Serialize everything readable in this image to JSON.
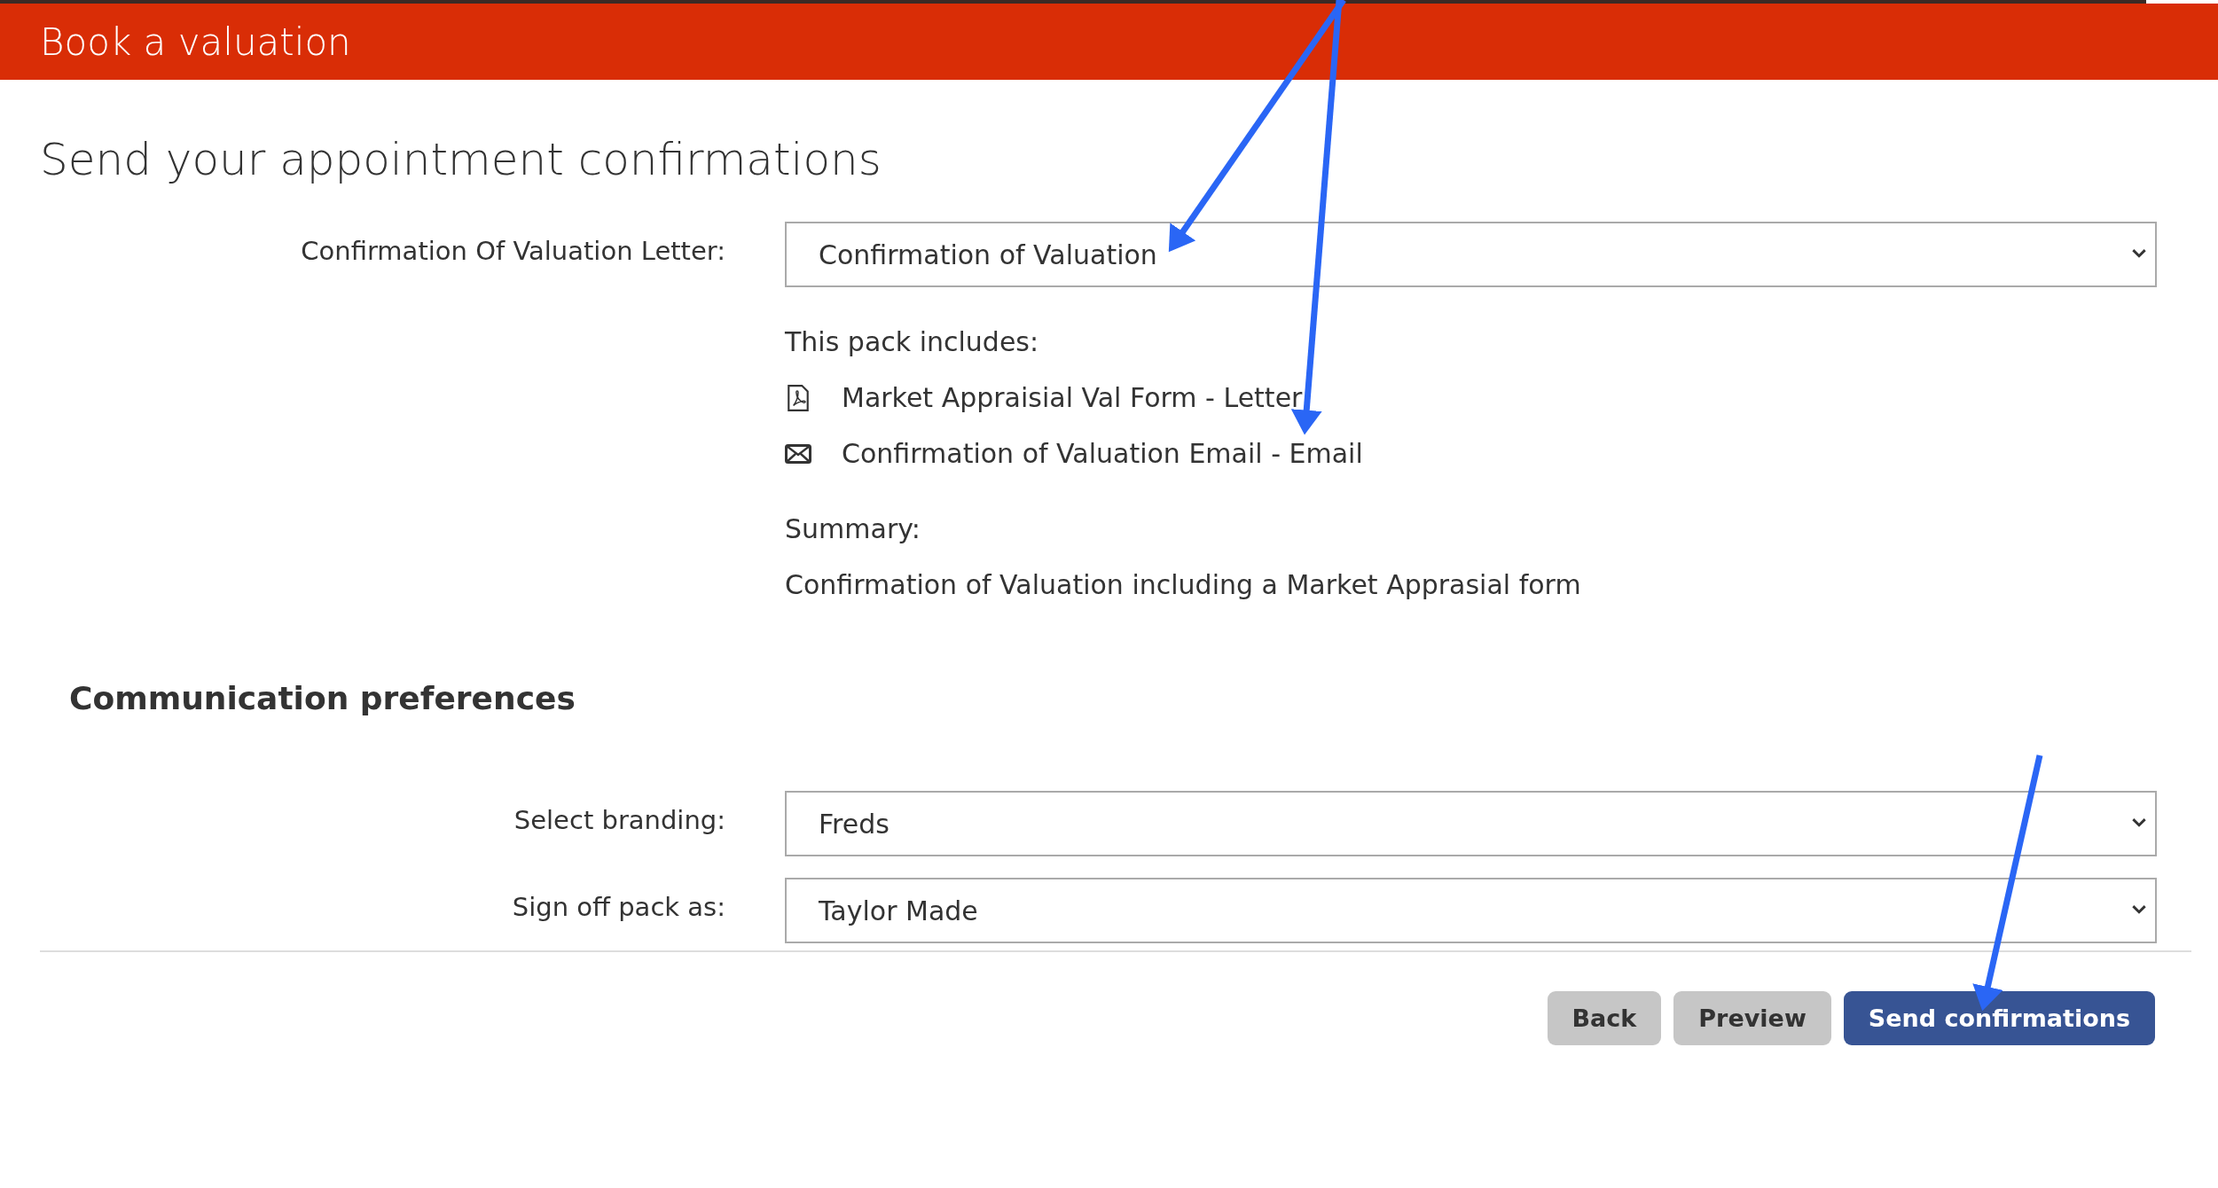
{
  "header": {
    "title": "Book a valuation"
  },
  "heading": "Send your appointment confirmations",
  "letter": {
    "label": "Confirmation Of Valuation Letter:",
    "value": "Confirmation of Valuation"
  },
  "pack": {
    "intro": "This pack includes:",
    "items": [
      {
        "kind": "pdf",
        "label": "Market Appraisial Val Form - Letter"
      },
      {
        "kind": "email",
        "label": "Confirmation of Valuation Email - Email"
      }
    ]
  },
  "summary": {
    "label": "Summary:",
    "text": "Confirmation of Valuation including a Market Apprasial form"
  },
  "preferences": {
    "title": "Communication preferences",
    "fields": [
      {
        "label": "Select branding:",
        "value": "Freds"
      },
      {
        "label": "Sign off pack as:",
        "value": "Taylor Made"
      }
    ]
  },
  "buttons": [
    {
      "kind": "secondary",
      "label": "Back"
    },
    {
      "kind": "secondary",
      "label": "Preview"
    },
    {
      "kind": "primary",
      "label": "Send confirmations"
    }
  ]
}
